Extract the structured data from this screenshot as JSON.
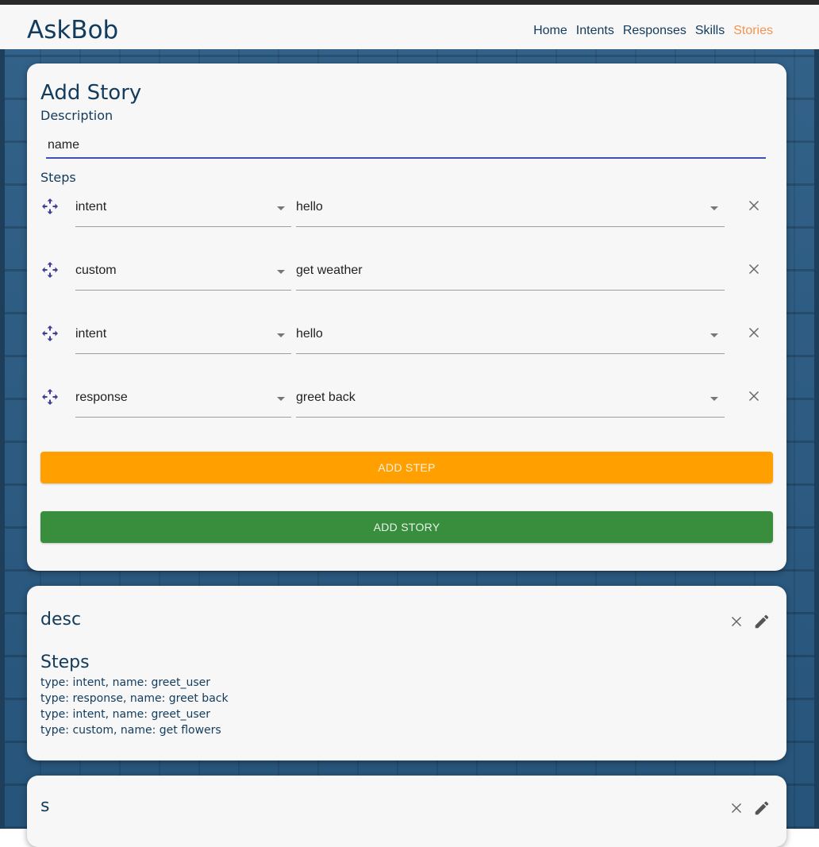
{
  "app": {
    "brand": "AskBob"
  },
  "nav": {
    "items": [
      {
        "label": "Home",
        "active": false
      },
      {
        "label": "Intents",
        "active": false
      },
      {
        "label": "Responses",
        "active": false
      },
      {
        "label": "Skills",
        "active": false
      },
      {
        "label": "Stories",
        "active": true
      }
    ]
  },
  "form": {
    "title": "Add Story",
    "description_label": "Description",
    "description_value": "name",
    "steps_label": "Steps",
    "steps": [
      {
        "type": "intent",
        "name": "hello",
        "name_is_select": true
      },
      {
        "type": "custom",
        "name": "get weather",
        "name_is_select": false
      },
      {
        "type": "intent",
        "name": "hello",
        "name_is_select": true
      },
      {
        "type": "response",
        "name": "greet back",
        "name_is_select": true
      }
    ],
    "add_step_label": "ADD STEP",
    "add_story_label": "ADD STORY"
  },
  "stories": [
    {
      "description": "desc",
      "steps_title": "Steps",
      "steps": [
        "type: intent, name: greet_user",
        "type: response, name: greet back",
        "type: intent, name: greet_user",
        "type: custom, name: get flowers"
      ]
    },
    {
      "description": "s"
    }
  ],
  "colors": {
    "accent_active": "#f5924e",
    "primary_text": "#123b5c",
    "add_step": "#ffa000",
    "add_story": "#388e3c",
    "input_underline": "#3f51b5",
    "background": "#2a5b84"
  },
  "icons": {
    "drag": "drag-move-icon",
    "remove": "close-icon",
    "edit": "pencil-icon",
    "dropdown": "caret-down-icon"
  }
}
